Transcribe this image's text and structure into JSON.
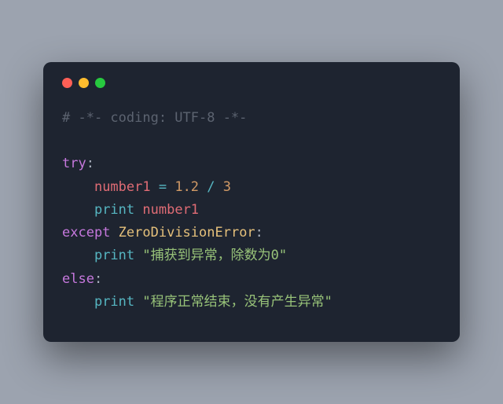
{
  "code": {
    "line1_comment": "# -*- coding: UTF-8 -*-",
    "try_kw": "try",
    "colon": ":",
    "var": "number1",
    "assign": " = ",
    "num1": "1.2",
    "div": " / ",
    "num2": "3",
    "print_kw": "print",
    "space": " ",
    "except_kw": "except",
    "exc_type": "ZeroDivisionError",
    "str_caught": "\"捕获到异常，除数为0\"",
    "else_kw": "else",
    "str_ok": "\"程序正常结束，没有产生异常\""
  },
  "indent": "    "
}
